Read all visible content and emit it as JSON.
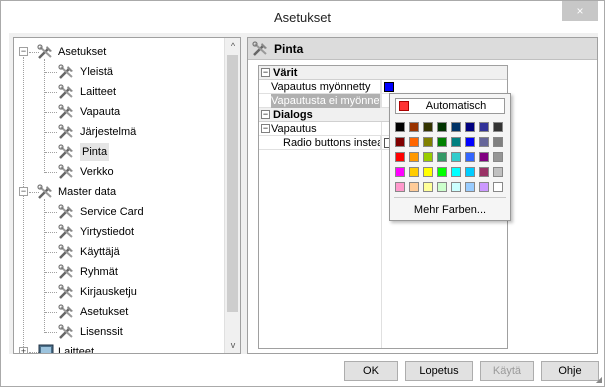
{
  "window": {
    "title": "Asetukset",
    "close_glyph": "×"
  },
  "tree": {
    "nodes": [
      {
        "label": "Asetukset",
        "expander": "−"
      },
      {
        "label": "Yleistä"
      },
      {
        "label": "Laitteet"
      },
      {
        "label": "Vapauta"
      },
      {
        "label": "Järjestelmä"
      },
      {
        "label": "Pinta"
      },
      {
        "label": "Verkko"
      },
      {
        "label": "Master data",
        "expander": "−"
      },
      {
        "label": "Service Card"
      },
      {
        "label": "Yirtystiedot"
      },
      {
        "label": "Käyttäjä"
      },
      {
        "label": "Ryhmät"
      },
      {
        "label": "Kirjausketju"
      },
      {
        "label": "Asetukset"
      },
      {
        "label": "Lisenssit"
      },
      {
        "label": "Laitteet",
        "expander": "+"
      }
    ],
    "scroll_up": "^",
    "scroll_down": "v",
    "icon": "tools-icon"
  },
  "panel": {
    "title": "Pinta",
    "grid": {
      "cat1": {
        "label": "Värit",
        "exp": "−"
      },
      "rows1": [
        {
          "label": "Vapautus myönnetty"
        },
        {
          "label": "Vapautusta ei myönnetty"
        }
      ],
      "cat2": {
        "label": "Dialogs",
        "exp": "−"
      },
      "cat2_row": {
        "label": "Vapautus",
        "exp": "−"
      },
      "rows2": [
        {
          "label": "Radio buttons instead ..."
        }
      ]
    }
  },
  "color_popup": {
    "auto_label": "Automatisch",
    "more_label": "Mehr Farben...",
    "palette": [
      [
        "#000000",
        "#993300",
        "#333300",
        "#003300",
        "#003366",
        "#000080",
        "#333399",
        "#333333"
      ],
      [
        "#800000",
        "#ff6600",
        "#808000",
        "#008000",
        "#008080",
        "#0000ff",
        "#666699",
        "#808080"
      ],
      [
        "#ff0000",
        "#ff9900",
        "#99cc00",
        "#339966",
        "#33cccc",
        "#3366ff",
        "#800080",
        "#969696"
      ],
      [
        "#ff00ff",
        "#ffcc00",
        "#ffff00",
        "#00ff00",
        "#00ffff",
        "#00ccff",
        "#993366",
        "#c0c0c0"
      ],
      [
        "#ff99cc",
        "#ffcc99",
        "#ffff99",
        "#ccffcc",
        "#ccffff",
        "#99ccff",
        "#cc99ff",
        "#ffffff"
      ]
    ]
  },
  "buttons": {
    "ok": "OK",
    "cancel": "Lopetus",
    "apply": "Käytä",
    "help": "Ohje"
  },
  "colors": {
    "accent_blue": "#0000ff",
    "selection": "#b0b0b0"
  }
}
